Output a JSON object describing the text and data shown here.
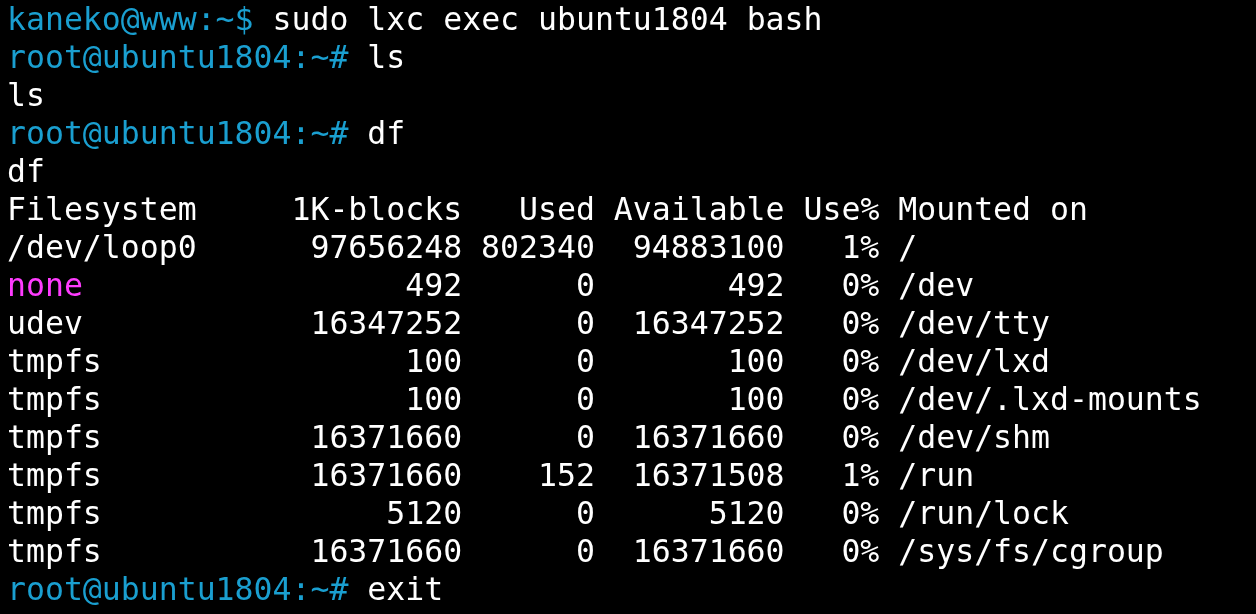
{
  "terminal": {
    "lines_before": [
      {
        "kind": "prompt",
        "prompt": "kaneko@www:~$",
        "command": "sudo lxc exec ubuntu1804 bash"
      },
      {
        "kind": "prompt",
        "prompt": "root@ubuntu1804:~#",
        "command": "ls"
      },
      {
        "kind": "output",
        "text": "ls"
      },
      {
        "kind": "prompt",
        "prompt": "root@ubuntu1804:~#",
        "command": "df"
      },
      {
        "kind": "output",
        "text": "df"
      }
    ],
    "table": {
      "columns": [
        "Filesystem",
        "1K-blocks",
        "Used",
        "Available",
        "Use%",
        "Mounted on"
      ],
      "rows": [
        {
          "color": "#ffffff",
          "cells": [
            "/dev/loop0",
            "97656248",
            "802340",
            "94883100",
            "1%",
            "/"
          ]
        },
        {
          "color": "#ff3cff",
          "cells": [
            "none",
            "492",
            "0",
            "492",
            "0%",
            "/dev"
          ]
        },
        {
          "color": "#ffffff",
          "cells": [
            "udev",
            "16347252",
            "0",
            "16347252",
            "0%",
            "/dev/tty"
          ]
        },
        {
          "color": "#ffffff",
          "cells": [
            "tmpfs",
            "100",
            "0",
            "100",
            "0%",
            "/dev/lxd"
          ]
        },
        {
          "color": "#ffffff",
          "cells": [
            "tmpfs",
            "100",
            "0",
            "100",
            "0%",
            "/dev/.lxd-mounts"
          ]
        },
        {
          "color": "#ffffff",
          "cells": [
            "tmpfs",
            "16371660",
            "0",
            "16371660",
            "0%",
            "/dev/shm"
          ]
        },
        {
          "color": "#ffffff",
          "cells": [
            "tmpfs",
            "16371660",
            "152",
            "16371508",
            "1%",
            "/run"
          ]
        },
        {
          "color": "#ffffff",
          "cells": [
            "tmpfs",
            "5120",
            "0",
            "5120",
            "0%",
            "/run/lock"
          ]
        },
        {
          "color": "#ffffff",
          "cells": [
            "tmpfs",
            "16371660",
            "0",
            "16371660",
            "0%",
            "/sys/fs/cgroup"
          ]
        }
      ]
    },
    "lines_after": [
      {
        "kind": "prompt",
        "prompt": "root@ubuntu1804:~#",
        "command": "exit"
      }
    ]
  }
}
